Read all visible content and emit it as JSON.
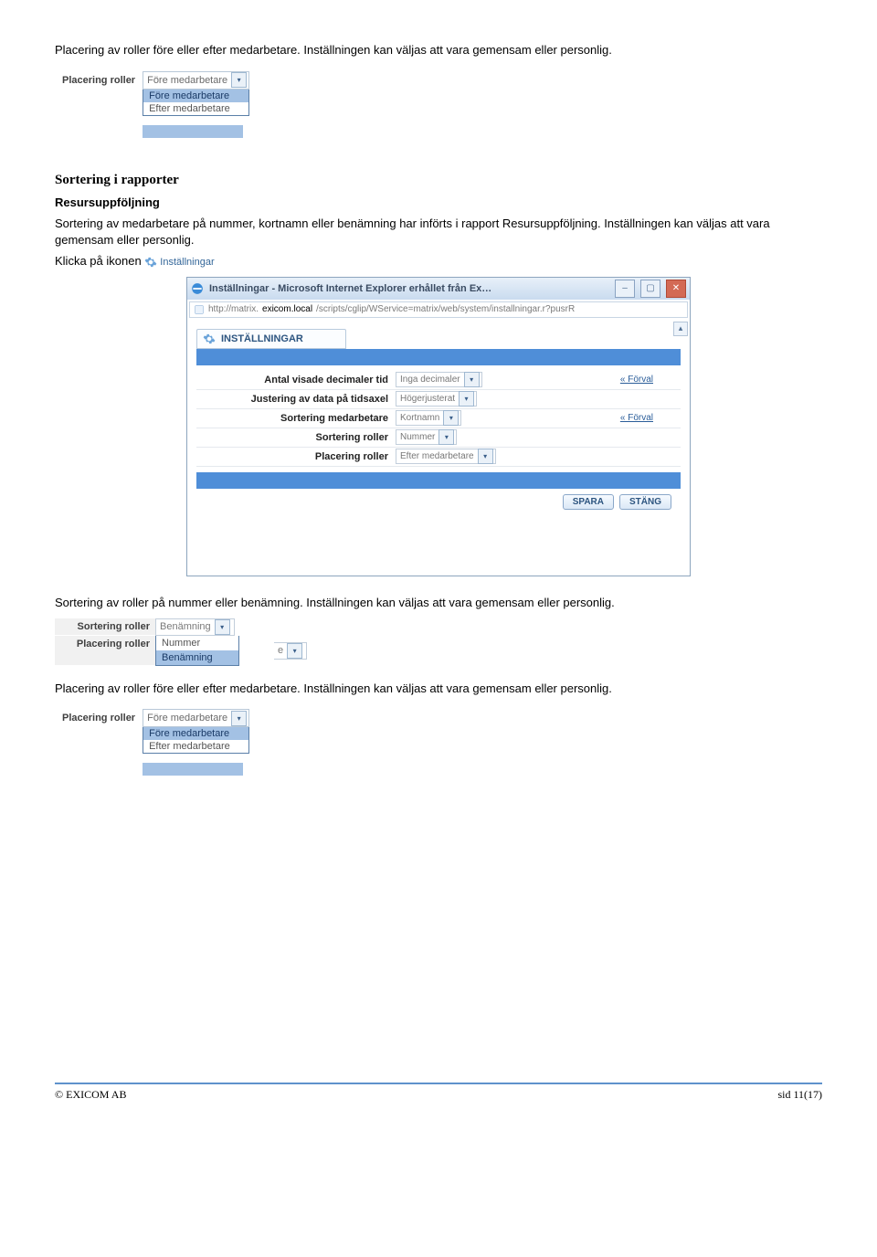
{
  "page": {
    "p1": "Placering av roller före eller efter medarbetare. Inställningen kan väljas att vara gemensam eller personlig.",
    "h1": "Sortering i rapporter",
    "h2": "Resursuppföljning",
    "p2": "Sortering av medarbetare på nummer, kortnamn eller benämning har införts i rapport Resursuppföljning. Inställningen kan väljas att vara gemensam eller personlig.",
    "p3a": "Klicka på ikonen",
    "p4": "Sortering av roller på nummer eller benämning. Inställningen kan väljas att vara gemensam eller personlig.",
    "p5": "Placering av roller före eller efter medarbetare. Inställningen kan väljas att vara gemensam eller personlig."
  },
  "iconlink": {
    "label": "Inställningar"
  },
  "placering_widget": {
    "label": "Placering roller",
    "selected": "Före medarbetare",
    "options": [
      "Före medarbetare",
      "Efter medarbetare"
    ],
    "highlight_index": 0
  },
  "ie": {
    "title": "Inställningar - Microsoft Internet Explorer erhållet från Ex…",
    "url_prefix": "http://matrix.",
    "url_domain": "exicom.local",
    "url_rest": "/scripts/cglip/WService=matrix/web/system/installningar.r?pusrR",
    "tab_title": "INSTÄLLNINGAR",
    "rows": [
      {
        "label": "Antal visade decimaler tid",
        "value": "Inga decimaler",
        "forval": "« Förval"
      },
      {
        "label": "Justering av data på tidsaxel",
        "value": "Högerjusterat",
        "forval": ""
      },
      {
        "label": "Sortering medarbetare",
        "value": "Kortnamn",
        "forval": "« Förval"
      },
      {
        "label": "Sortering roller",
        "value": "Nummer",
        "forval": ""
      },
      {
        "label": "Placering roller",
        "value": "Efter medarbetare",
        "forval": ""
      }
    ],
    "spara": "SPARA",
    "stang": "STÄNG"
  },
  "sort_widget": {
    "row1_label": "Sortering roller",
    "row1_value": "Benämning",
    "row2_label": "Placering roller",
    "row2_list": [
      "Nummer",
      "Benämning"
    ],
    "row2_tail": "e",
    "highlight_index": 1
  },
  "footer": {
    "left": "© EXICOM AB",
    "right": "sid 11(17)"
  }
}
